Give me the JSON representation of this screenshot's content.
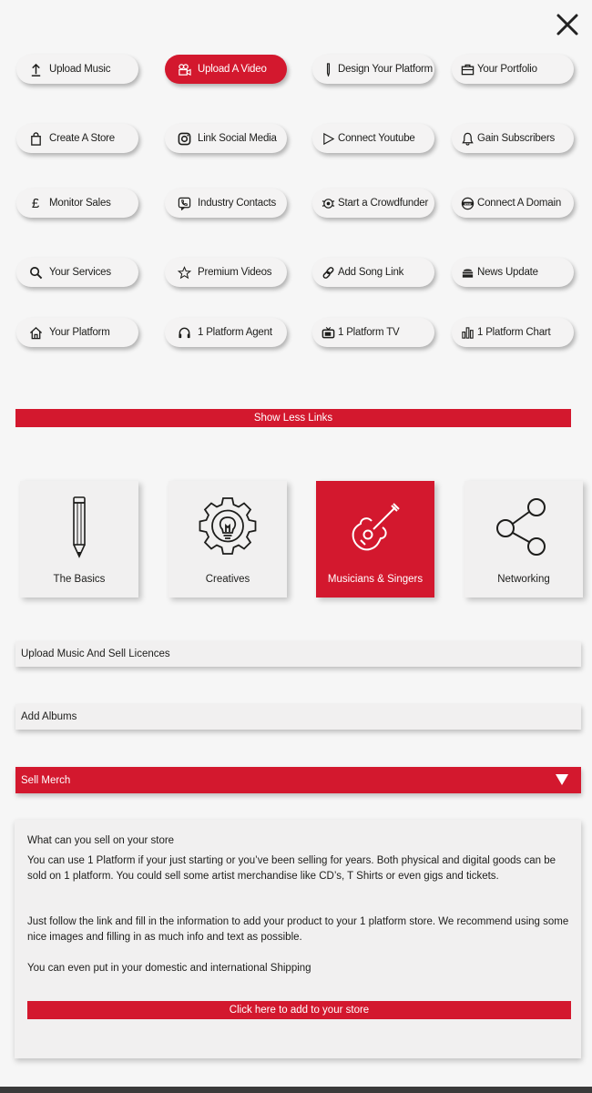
{
  "close_icon": "close-x-icon",
  "links": [
    {
      "label": "Upload Music",
      "icon": "upload-arrow-icon",
      "active": false
    },
    {
      "label": "Upload A Video",
      "icon": "video-camera-icon",
      "active": true
    },
    {
      "label": "Design Your Platform",
      "icon": "pencil-icon",
      "active": false
    },
    {
      "label": "Your Portfolio",
      "icon": "briefcase-icon",
      "active": false
    },
    {
      "label": "Create A Store",
      "icon": "shopping-bag-icon",
      "active": false
    },
    {
      "label": "Link Social Media",
      "icon": "instagram-icon",
      "active": false
    },
    {
      "label": "Connect Youtube",
      "icon": "play-icon",
      "active": false
    },
    {
      "label": "Gain Subscribers",
      "icon": "bell-icon",
      "active": false
    },
    {
      "label": "Monitor Sales",
      "icon": "pound-icon",
      "active": false
    },
    {
      "label": "Industry Contacts",
      "icon": "phone-contact-icon",
      "active": false
    },
    {
      "label": "Start a Crowdfunder",
      "icon": "crowdfunder-icon",
      "active": false
    },
    {
      "label": "Connect A Domain",
      "icon": "domain-icon",
      "active": false
    },
    {
      "label": "Your Services",
      "icon": "search-icon",
      "active": false
    },
    {
      "label": "Premium Videos",
      "icon": "star-icon",
      "active": false
    },
    {
      "label": "Add Song Link",
      "icon": "link-icon",
      "active": false
    },
    {
      "label": "News Update",
      "icon": "news-icon",
      "active": false
    },
    {
      "label": "Your Platform",
      "icon": "home-icon",
      "active": false
    },
    {
      "label": "1 Platform Agent",
      "icon": "headset-icon",
      "active": false
    },
    {
      "label": "1 Platform TV",
      "icon": "tv-icon",
      "active": false
    },
    {
      "label": "1 Platform Chart",
      "icon": "bar-chart-icon",
      "active": false
    }
  ],
  "show_less_label": "Show Less Links",
  "categories": [
    {
      "label": "The Basics",
      "icon": "pencil-icon",
      "active": false
    },
    {
      "label": "Creatives",
      "icon": "gear-lightbulb-icon",
      "active": false
    },
    {
      "label": "Musicians & Singers",
      "icon": "guitar-icon",
      "active": true
    },
    {
      "label": "Networking",
      "icon": "share-icon",
      "active": false
    }
  ],
  "accordion": [
    {
      "label": "Upload Music And Sell Licences",
      "open": false
    },
    {
      "label": "Add Albums",
      "open": false
    },
    {
      "label": "Sell Merch",
      "open": true
    }
  ],
  "panel": {
    "heading": "What can you sell on your store",
    "para1": "You can use 1 Platform if your just starting or you’ve been selling for years. Both physical and digital goods can be sold on 1 platform. You could sell some artist merchandise like CD’s, T Shirts or even gigs and tickets.",
    "para2": "Just follow the link and fill in the information to add your product to your 1 platform store. We recommend using some nice images and filling in as much info and text as possible.",
    "para3": "You can even put in your domestic and international Shipping",
    "cta_label": "Click here to add to your store"
  },
  "colors": {
    "accent": "#d3182e",
    "background": "#f6f6f6",
    "card": "#f1f0f0",
    "text": "#1d1d1b"
  }
}
